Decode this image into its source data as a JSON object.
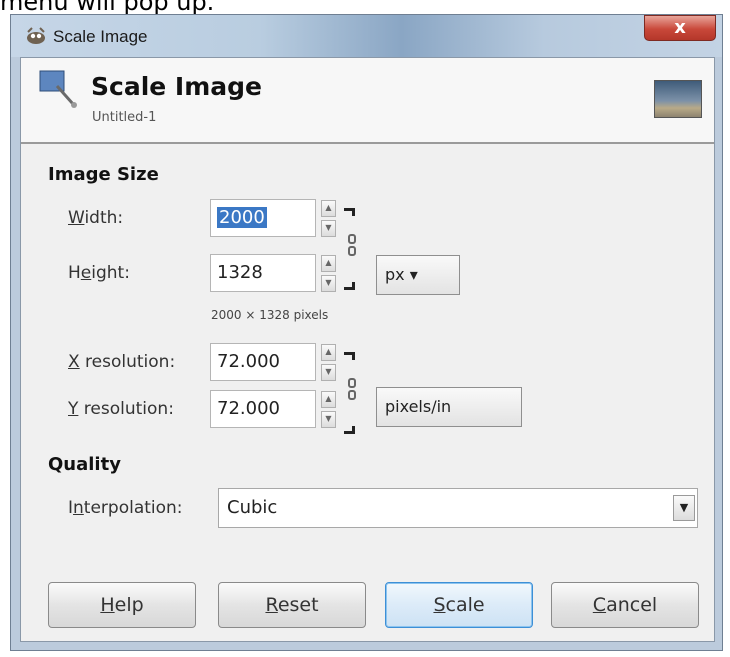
{
  "caption": "menu will pop up.",
  "window": {
    "title": "Scale Image",
    "close_glyph": "x"
  },
  "header": {
    "title": "Scale Image",
    "subtitle": "Untitled-1"
  },
  "image_size": {
    "section": "Image Size",
    "width_label_a": "W",
    "width_label_b": "idth:",
    "width_value": "2000",
    "height_label_a": "H",
    "height_label_u": "e",
    "height_label_b": "ight:",
    "height_value": "1328",
    "unit": "px",
    "pixels_note": "2000 × 1328 pixels",
    "xres_label_a": "X",
    "xres_label_b": " resolution:",
    "xres_value": "72.000",
    "yres_label_a": "Y",
    "yres_label_b": " resolution:",
    "yres_value": "72.000",
    "res_unit": "pixels/in"
  },
  "quality": {
    "section": "Quality",
    "interp_label_a": "I",
    "interp_label_u": "n",
    "interp_label_b": "terpolation:",
    "interp_value": "Cubic"
  },
  "buttons": {
    "help_u": "H",
    "help_rest": "elp",
    "reset_u": "R",
    "reset_rest": "eset",
    "scale_u": "S",
    "scale_rest": "cale",
    "cancel_u": "C",
    "cancel_rest": "ancel"
  }
}
